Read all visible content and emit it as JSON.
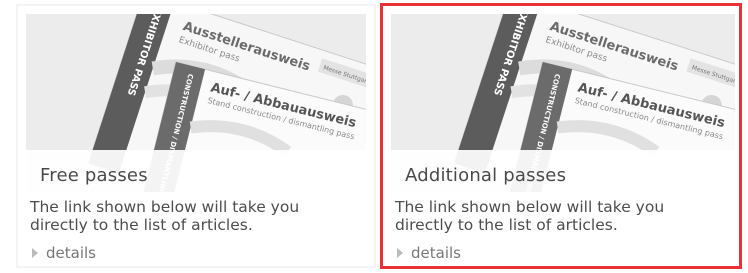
{
  "cards": [
    {
      "title": "Free passes",
      "description": "The link shown below will take you directly to the list of articles.",
      "details_label": "details",
      "image_text": {
        "exhibitor_vertical": "EXHIBITOR PASS",
        "card1_title": "Ausstellerausweis",
        "card1_sub": "Exhibitor pass",
        "card2_title": "Auf- / Abbauausweis",
        "card2_sub": "Stand construction / dismantling pass",
        "construction_vertical": "CONSTRUCTION / DISMANTLING PASS",
        "badge": "Messe Stuttgart"
      }
    },
    {
      "title": "Additional passes",
      "description": "The link shown below will take you directly to the list of articles.",
      "details_label": "details",
      "image_text": {
        "exhibitor_vertical": "EXHIBITOR PASS",
        "card1_title": "Ausstellerausweis",
        "card1_sub": "Exhibitor pass",
        "card2_title": "Auf- / Abbauausweis",
        "card2_sub": "Stand construction / dismantling pass",
        "construction_vertical": "CONSTRUCTION / DISMANTLING PASS",
        "badge": "Messe Stuttgart"
      }
    }
  ],
  "colors": {
    "selection_border": "#e8323a",
    "card_border": "#f3f3f3"
  }
}
